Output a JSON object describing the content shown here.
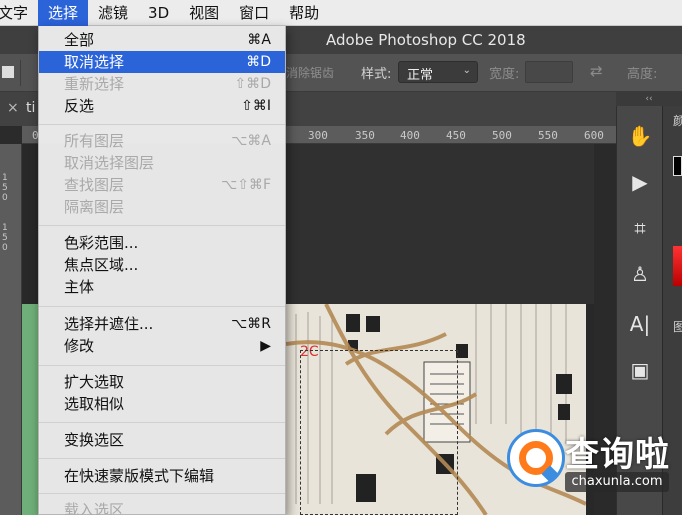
{
  "menubar": {
    "items": [
      {
        "label": "文字",
        "active": false
      },
      {
        "label": "选择",
        "active": true
      },
      {
        "label": "滤镜",
        "active": false
      },
      {
        "label": "3D",
        "active": false
      },
      {
        "label": "视图",
        "active": false
      },
      {
        "label": "窗口",
        "active": false
      },
      {
        "label": "帮助",
        "active": false
      }
    ]
  },
  "window": {
    "title": "Adobe Photoshop CC 2018"
  },
  "options_bar": {
    "antialias_label": "消除锯齿",
    "style_label": "样式:",
    "style_value": "正常",
    "width_label": "宽度:",
    "height_label": "高度:"
  },
  "document": {
    "tab_label": "ti"
  },
  "ruler": {
    "h_ticks": [
      "0",
      "300",
      "350",
      "400",
      "450",
      "500",
      "550",
      "600"
    ],
    "v_ticks": [
      "1",
      "5",
      "0",
      "1",
      "5",
      "0"
    ]
  },
  "select_menu": {
    "items": [
      {
        "label": "全部",
        "shortcut": "⌘A",
        "disabled": false,
        "highlight": false
      },
      {
        "label": "取消选择",
        "shortcut": "⌘D",
        "disabled": false,
        "highlight": true
      },
      {
        "label": "重新选择",
        "shortcut": "⇧⌘D",
        "disabled": true,
        "highlight": false
      },
      {
        "label": "反选",
        "shortcut": "⇧⌘I",
        "disabled": false,
        "highlight": false
      },
      {
        "label": "所有图层",
        "shortcut": "⌥⌘A",
        "disabled": true,
        "highlight": false
      },
      {
        "label": "取消选择图层",
        "shortcut": "",
        "disabled": true,
        "highlight": false
      },
      {
        "label": "查找图层",
        "shortcut": "⌥⇧⌘F",
        "disabled": true,
        "highlight": false
      },
      {
        "label": "隔离图层",
        "shortcut": "",
        "disabled": true,
        "highlight": false
      },
      {
        "label": "色彩范围...",
        "shortcut": "",
        "disabled": false,
        "highlight": false
      },
      {
        "label": "焦点区域...",
        "shortcut": "",
        "disabled": false,
        "highlight": false
      },
      {
        "label": "主体",
        "shortcut": "",
        "disabled": false,
        "highlight": false
      },
      {
        "label": "选择并遮住...",
        "shortcut": "⌥⌘R",
        "disabled": false,
        "highlight": false
      },
      {
        "label": "修改",
        "shortcut": "▶",
        "disabled": false,
        "highlight": false
      },
      {
        "label": "扩大选取",
        "shortcut": "",
        "disabled": false,
        "highlight": false
      },
      {
        "label": "选取相似",
        "shortcut": "",
        "disabled": false,
        "highlight": false
      },
      {
        "label": "变换选区",
        "shortcut": "",
        "disabled": false,
        "highlight": false
      },
      {
        "label": "在快速蒙版模式下编辑",
        "shortcut": "",
        "disabled": false,
        "highlight": false
      },
      {
        "label": "载入选区",
        "shortcut": "",
        "disabled": true,
        "highlight": false
      }
    ]
  },
  "right_panel": {
    "collapse_label": "‹‹",
    "tools": [
      "brush-tool-icon",
      "play-icon",
      "crop-icon",
      "stamp-icon",
      "type-icon",
      "3d-cube-icon"
    ],
    "labels": [
      "颜",
      "图"
    ]
  },
  "watermark": {
    "main": "查询啦",
    "sub": "chaxunla.com",
    "colors": {
      "blue": "#3c8de0",
      "orange": "#ff7a1a"
    }
  },
  "colors": {
    "menu_highlight": "#2b63d9",
    "ps_panel": "#535353"
  }
}
